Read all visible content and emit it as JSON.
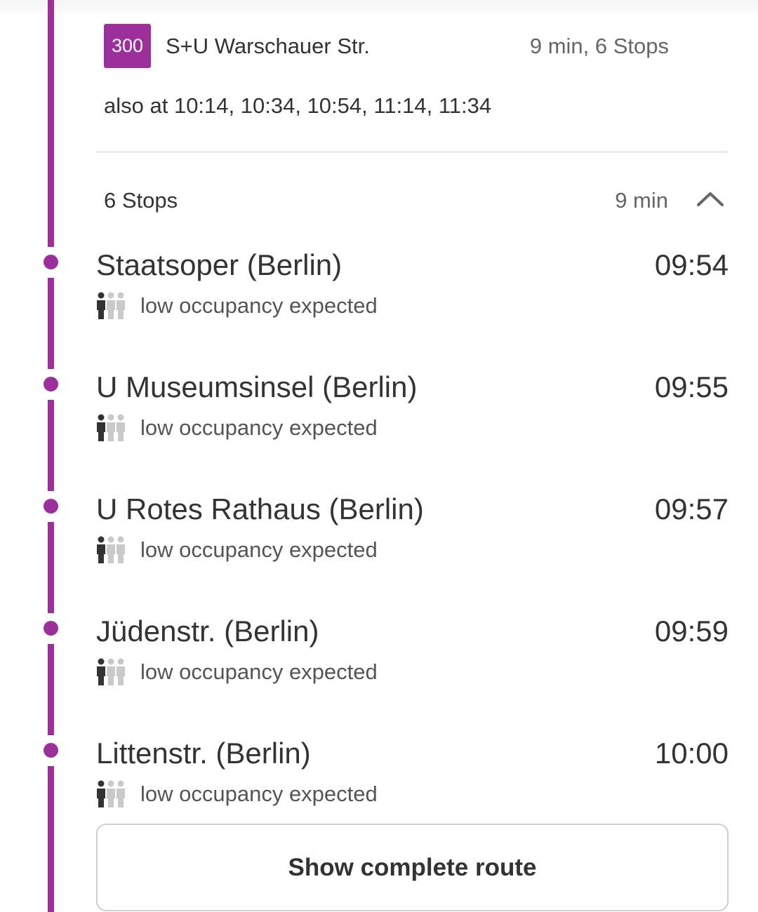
{
  "accent_color": "#9c2f9c",
  "trip": {
    "line": "300",
    "destination": "S+U Warschauer Str.",
    "summary": "9 min, 6 Stops",
    "also_at": "also at 10:14, 10:34, 10:54, 11:14, 11:34"
  },
  "stops_toggle": {
    "count_label": "6 Stops",
    "duration_label": "9 min",
    "icon": "chevron-up-icon",
    "expanded": true
  },
  "stops": [
    {
      "name": "Staatsoper (Berlin)",
      "time": "09:54",
      "occupancy": "low occupancy expected",
      "icon": "occupancy-low-icon"
    },
    {
      "name": "U Museumsinsel (Berlin)",
      "time": "09:55",
      "occupancy": "low occupancy expected",
      "icon": "occupancy-low-icon"
    },
    {
      "name": "U Rotes Rathaus (Berlin)",
      "time": "09:57",
      "occupancy": "low occupancy expected",
      "icon": "occupancy-low-icon"
    },
    {
      "name": "Jüdenstr. (Berlin)",
      "time": "09:59",
      "occupancy": "low occupancy expected",
      "icon": "occupancy-low-icon"
    },
    {
      "name": "Littenstr. (Berlin)",
      "time": "10:00",
      "occupancy": "low occupancy expected",
      "icon": "occupancy-low-icon"
    }
  ],
  "complete_route_button": "Show complete route"
}
